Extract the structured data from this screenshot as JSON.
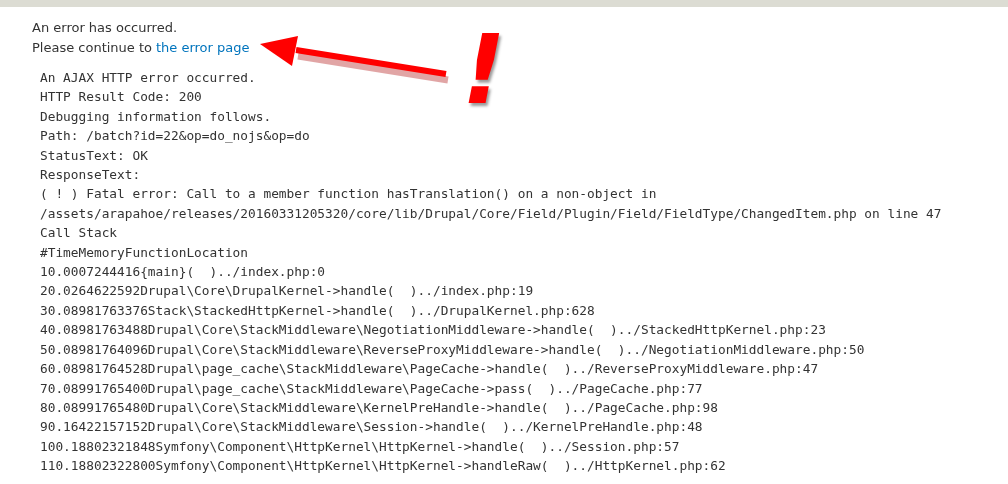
{
  "message": {
    "heading": "An error has occurred.",
    "prompt": "Please continue to",
    "link": "the error page"
  },
  "annotation": {
    "mark": "!"
  },
  "debug_lines": [
    "An AJAX HTTP error occurred.",
    "HTTP Result Code: 200",
    "Debugging information follows.",
    "Path: /batch?id=22&op=do_nojs&op=do",
    "StatusText: OK",
    "ResponseText:",
    "( ! ) Fatal error: Call to a member function hasTranslation() on a non-object in",
    "/assets/arapahoe/releases/20160331205320/core/lib/Drupal/Core/Field/Plugin/Field/FieldType/ChangedItem.php on line 47",
    "Call Stack",
    "#TimeMemoryFunctionLocation",
    "10.0007244416{main}(  )../index.php:0",
    "20.0264622592Drupal\\Core\\DrupalKernel->handle(  )../index.php:19",
    "30.08981763376Stack\\StackedHttpKernel->handle(  )../DrupalKernel.php:628",
    "40.08981763488Drupal\\Core\\StackMiddleware\\NegotiationMiddleware->handle(  )../StackedHttpKernel.php:23",
    "50.08981764096Drupal\\Core\\StackMiddleware\\ReverseProxyMiddleware->handle(  )../NegotiationMiddleware.php:50",
    "60.08981764528Drupal\\page_cache\\StackMiddleware\\PageCache->handle(  )../ReverseProxyMiddleware.php:47",
    "70.08991765400Drupal\\page_cache\\StackMiddleware\\PageCache->pass(  )../PageCache.php:77",
    "80.08991765480Drupal\\Core\\StackMiddleware\\KernelPreHandle->handle(  )../PageCache.php:98",
    "90.16422157152Drupal\\Core\\StackMiddleware\\Session->handle(  )../KernelPreHandle.php:48",
    "100.18802321848Symfony\\Component\\HttpKernel\\HttpKernel->handle(  )../Session.php:57",
    "110.18802322800Symfony\\Component\\HttpKernel\\HttpKernel->handleRaw(  )../HttpKernel.php:62"
  ]
}
